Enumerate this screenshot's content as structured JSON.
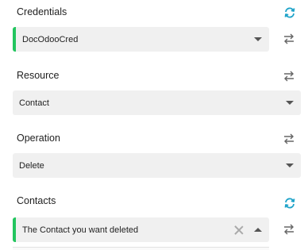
{
  "credentials": {
    "label": "Credentials",
    "value": "DocOdooCred",
    "icons": {
      "label_side": "refresh-icon",
      "field_side": "swap-arrows-icon"
    }
  },
  "resource": {
    "label": "Resource",
    "value": "Contact",
    "icons": {
      "label_side": "swap-arrows-icon"
    }
  },
  "operation": {
    "label": "Operation",
    "value": "Delete",
    "icons": {
      "label_side": "swap-arrows-icon"
    }
  },
  "contacts": {
    "label": "Contacts",
    "value": "The Contact you want deleted",
    "icons": {
      "label_side": "refresh-icon",
      "field_side": "swap-arrows-icon"
    }
  },
  "colors": {
    "accent_green": "#22c55e",
    "refresh_teal": "#1fa3c9",
    "field_bg": "#f0f0f0"
  }
}
